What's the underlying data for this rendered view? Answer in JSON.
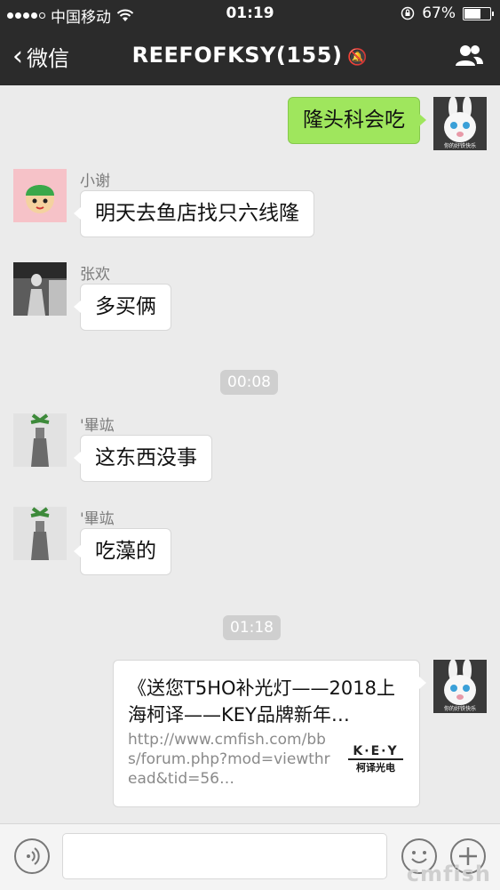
{
  "status": {
    "carrier": "中国移动",
    "time": "01:19",
    "battery": "67%"
  },
  "nav": {
    "back_label": "微信",
    "title": "REEFOFKSY(155)"
  },
  "messages": [
    {
      "sender": "",
      "text": "隆头科会吃"
    },
    {
      "sender": "小谢",
      "text": "明天去鱼店找只六线隆"
    },
    {
      "sender": "张欢",
      "text": "多买俩"
    },
    {
      "sender": "'畢竑",
      "text": "这东西没事"
    },
    {
      "sender": "'畢竑",
      "text": "吃藻的"
    }
  ],
  "timestamps": [
    "00:08",
    "01:18"
  ],
  "link_card": {
    "title": "《送您T5HO补光灯——2018上海柯译——KEY品牌新年…",
    "url": "http://www.cmfish.com/bbs/forum.php?mod=viewthread&tid=56…",
    "logo_text": "K·E·Y",
    "logo_sub": "柯译光电"
  },
  "avatars": {
    "me_caption": "你的好铁快乐"
  },
  "watermark": "cmfish"
}
